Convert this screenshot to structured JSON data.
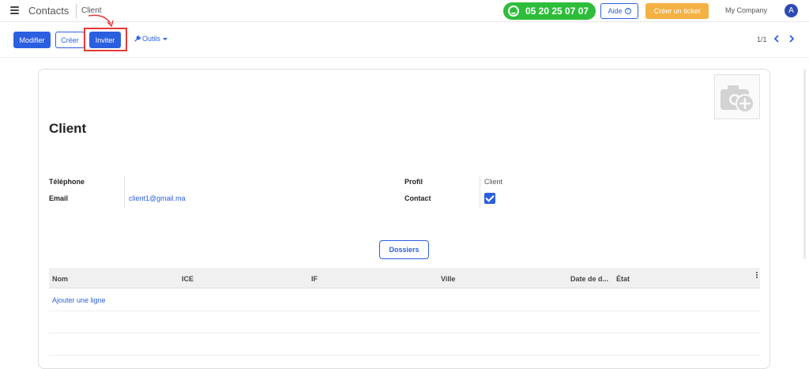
{
  "topbar": {
    "app_title": "Contacts",
    "breadcrumb": "Client",
    "phone": "05 20 25 07 07",
    "help_label": "Aide",
    "ticket_label": "Créer un ticket",
    "company": "My Company",
    "avatar_letter": "A"
  },
  "controls": {
    "edit_label": "Modifier",
    "create_label": "Créer",
    "invite_label": "Inviter",
    "tools_label": "Outils",
    "pager": "1/1"
  },
  "record": {
    "name": "Client",
    "phone_label": "Téléphone",
    "phone_value": "",
    "email_label": "Email",
    "email_value": "client1@gmail.ma",
    "profile_label": "Profil",
    "profile_value": "Client",
    "contact_label": "Contact",
    "contact_checked": true,
    "dossiers_label": "Dossiers"
  },
  "table": {
    "columns": [
      "Nom",
      "ICE",
      "IF",
      "Ville",
      "Date de d...",
      "État"
    ],
    "add_line_label": "Ajouter une ligne"
  },
  "colors": {
    "primary": "#2c5fe0",
    "phone_green": "#2ebd3a",
    "ticket_orange": "#f4b144",
    "highlight_red": "#e53935"
  }
}
